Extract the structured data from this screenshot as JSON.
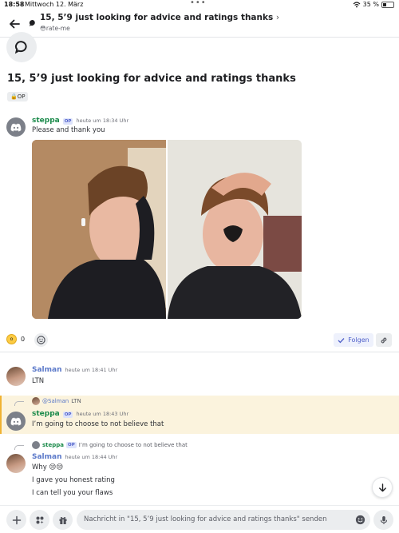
{
  "status_bar": {
    "time": "18:58",
    "date": "Mittwoch 12. März",
    "battery": "35 %",
    "battery_level": 0.35
  },
  "header": {
    "title": "15, 5’9 just looking for advice and ratings thanks",
    "chevron": "›",
    "channel": "rate-me"
  },
  "thread": {
    "title": "15, 5’9 just looking for advice and ratings thanks",
    "tag": "OP"
  },
  "op_badge": "OP",
  "messages": [
    {
      "author": "steppa",
      "time": "heute um 18:34 Uhr",
      "text": "Please and thank you"
    },
    {
      "author": "Salman",
      "time": "heute um 18:41 Uhr",
      "text": "LTN"
    },
    {
      "reply_to_author": "@Salman",
      "reply_to_text": "LTN",
      "author": "steppa",
      "time": "heute um 18:43 Uhr",
      "text": "I’m going to choose to not believe that"
    },
    {
      "reply_to_author": "steppa",
      "reply_to_text": "I’m going to choose to not believe that",
      "author": "Salman",
      "time": "heute um 18:44 Uhr",
      "lines": [
        "Why 😒😒",
        "I gave you honest rating",
        "I can tell you your flaws"
      ]
    }
  ],
  "reactions": {
    "count": "0"
  },
  "follow_label": "Folgen",
  "composer": {
    "placeholder": "Nachricht in \"15, 5’9 just looking for advice and ratings thanks\" senden"
  },
  "icons": [
    "back-arrow-icon",
    "chat-bubble-icon",
    "discord-logo-icon",
    "add-reaction-icon",
    "check-icon",
    "link-icon",
    "arrow-down-icon",
    "plus-icon",
    "apps-icon",
    "gift-icon",
    "emoji-icon",
    "microphone-icon",
    "wifi-icon",
    "battery-icon"
  ],
  "colors": {
    "accent": "#5865f2",
    "steppa": "#1a8a4a",
    "salman": "#5b79c9",
    "reply_highlight": "#fbf3dd"
  }
}
